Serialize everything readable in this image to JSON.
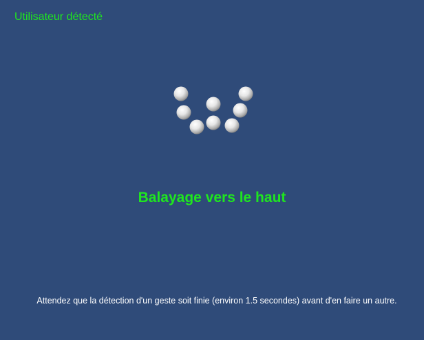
{
  "status": {
    "text": "Utilisateur détecté",
    "color": "#1fe61f"
  },
  "gesture": {
    "text": "Balayage vers le haut",
    "color": "#1fe61f"
  },
  "instruction": {
    "text": "Attendez que la détection d'un geste soit finie (environ 1.5 secondes) avant d'en faire un autre."
  },
  "colors": {
    "background": "#2f4b79",
    "sphere": "#e8e8e8"
  }
}
